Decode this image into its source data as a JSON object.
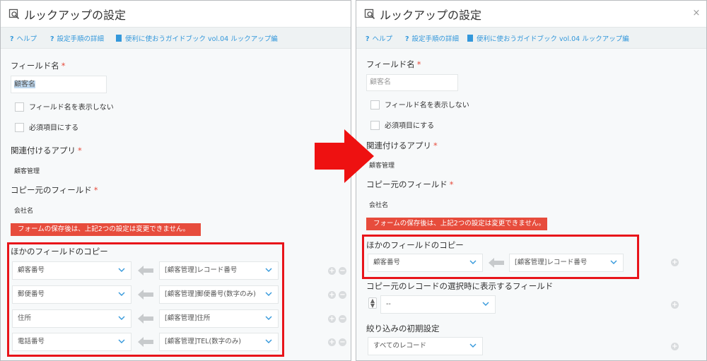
{
  "dialog": {
    "title": "ルックアップの設定",
    "close_icon": "×",
    "links": {
      "help": "ヘルプ",
      "steps": "設定手順の詳細",
      "guidebook": "便利に使おうガイドブック vol.04 ルックアップ編"
    }
  },
  "form": {
    "field_name_label": "フィールド名",
    "required_mark": "*",
    "field_name_value": "顧客名",
    "hide_label_checkbox": "フィールド名を表示しない",
    "required_checkbox": "必須項目にする",
    "related_app_label": "関連付けるアプリ",
    "related_app_value": "顧客管理",
    "copy_source_label": "コピー元のフィールド",
    "copy_source_value": "会社名",
    "warning": "フォームの保存後は、上記2つの設定は変更できません。",
    "copy_other_label": "ほかのフィールドのコピー"
  },
  "left_mappings": [
    {
      "target": "顧客番号",
      "source": "[顧客管理]レコード番号"
    },
    {
      "target": "郵便番号",
      "source": "[顧客管理]郵便番号(数字のみ)"
    },
    {
      "target": "住所",
      "source": "[顧客管理]住所"
    },
    {
      "target": "電話番号",
      "source": "[顧客管理]TEL(数字のみ)"
    }
  ],
  "right_mappings": [
    {
      "target": "顧客番号",
      "source": "[顧客管理]レコード番号"
    }
  ],
  "right_extra": {
    "display_fields_label": "コピー元のレコードの選択時に表示するフィールド",
    "display_fields_value": "--",
    "filter_label": "絞り込みの初期設定",
    "filter_value": "すべてのレコード"
  },
  "icons": {
    "help": "question-icon",
    "doc": "document-icon",
    "title": "lookup-icon",
    "arrow": "big-right-arrow-icon"
  },
  "colors": {
    "accent": "#3498db",
    "warning": "#e74c3c",
    "highlight_box": "#e8141a"
  }
}
